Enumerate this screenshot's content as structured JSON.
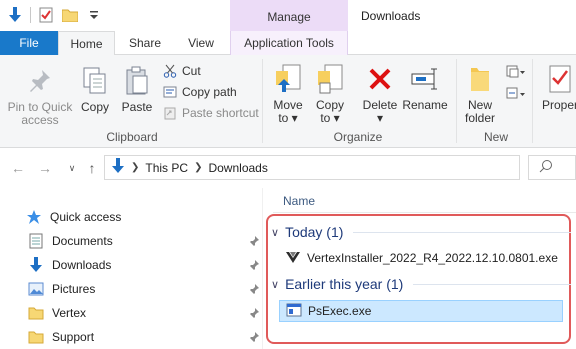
{
  "window": {
    "title": "Downloads",
    "context_tab": "Manage"
  },
  "tabs": {
    "file": "File",
    "home": "Home",
    "share": "Share",
    "view": "View",
    "app_tools": "Application Tools"
  },
  "ribbon": {
    "pin_to_quick_access": "Pin to Quick\naccess",
    "copy": "Copy",
    "paste": "Paste",
    "cut": "Cut",
    "copy_path": "Copy path",
    "paste_shortcut": "Paste shortcut",
    "clipboard_group": "Clipboard",
    "move_to": "Move\nto ▾",
    "copy_to": "Copy\nto ▾",
    "delete": "Delete\n▾",
    "rename": "Rename",
    "organize_group": "Organize",
    "new_folder": "New\nfolder",
    "new_group": "New",
    "properties": "Proper"
  },
  "address": {
    "this_pc": "This PC",
    "downloads": "Downloads"
  },
  "nav": {
    "quick_access": "Quick access",
    "items": [
      "Documents",
      "Downloads",
      "Pictures",
      "Vertex",
      "Support"
    ]
  },
  "files": {
    "column_name": "Name",
    "groups": [
      {
        "label": "Today (1)",
        "files": [
          "VertexInstaller_2022_R4_2022.12.10.0801.exe"
        ]
      },
      {
        "label": "Earlier this year (1)",
        "files": [
          "PsExec.exe"
        ]
      }
    ]
  },
  "colors": {
    "file_tab": "#1979ca",
    "manage": "#ecdcf7",
    "selection": "#cce8ff",
    "highlight": "#e05a5a"
  }
}
